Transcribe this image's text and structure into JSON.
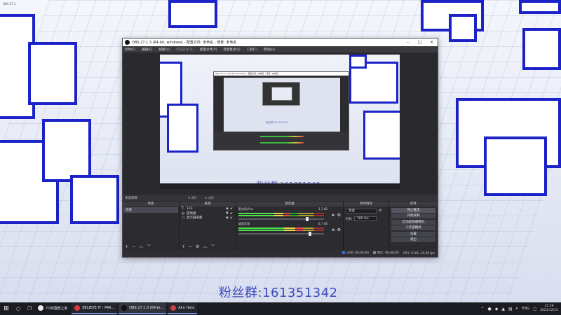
{
  "desktop": {
    "corner_label": "OBS 27.1",
    "fan_overlay": "粉丝群:161351342"
  },
  "obs": {
    "title": "OBS 27.1.3 (64-bit, windows) - 配置文件: 未命名 - 场景: 未命名",
    "menu": [
      "文件(F)",
      "编辑(E)",
      "视图(V)",
      "停靠部件(D)",
      "配置文件(P)",
      "场景集合(S)",
      "工具(T)",
      "帮助(H)"
    ],
    "preview": {
      "inner_title": "OBS 27.1.3 (64-bit, windows) - 配置文件: 未命名 - 场景: 未命名",
      "inner_fan": "粉丝群:161351342",
      "fan": "粉丝群:161351342"
    },
    "dock_bar": {
      "label": "未选择源",
      "properties": "属性",
      "filters": "滤镜"
    },
    "scenes": {
      "header": "场景",
      "items": [
        "场景"
      ]
    },
    "sources": {
      "header": "来源",
      "items": [
        {
          "name": "123",
          "icon": "text-icon"
        },
        {
          "name": "游戏源",
          "icon": "gamepad-icon"
        },
        {
          "name": "显示器采集",
          "icon": "monitor-icon"
        }
      ]
    },
    "mixer": {
      "header": "混音器",
      "tracks": [
        {
          "name": "麦克风/Aux",
          "db": "-1.1 dB",
          "level": 0.6,
          "volume": 0.8
        },
        {
          "name": "桌面音频",
          "db": "-2.7 dB",
          "level": 0.75,
          "volume": 0.84
        }
      ]
    },
    "transitions": {
      "header": "转场特效",
      "type": "渐变",
      "duration_label": "时长",
      "duration": "300 ms"
    },
    "controls": {
      "header": "控件",
      "buttons": [
        "停止推流",
        "开始录制",
        "启动虚拟摄像机",
        "工作室模式",
        "设置",
        "退出"
      ]
    },
    "status": {
      "live": "LIVE: 00:00:00",
      "rec": "REC: 00:00:00",
      "cpu": "CPU: 5.0%, 30.00 fps"
    }
  },
  "taskbar": {
    "apps": [
      {
        "label": "77的围脖之家",
        "color": "#e8e8e8"
      },
      {
        "label": "BELIEVE IT - PAR...",
        "color": "#d93a3a"
      },
      {
        "label": "OBS 27.1.3 (64-bi...",
        "color": "#111111"
      },
      {
        "label": "Aim Hero",
        "color": "#c84040"
      }
    ],
    "lang": "ENG",
    "time": "21:29",
    "date": "2021/12/12"
  },
  "colors": {
    "accent_blue": "#1a22c8",
    "obs_bg": "#2b2b30",
    "meter_green": "#4ce04c"
  }
}
